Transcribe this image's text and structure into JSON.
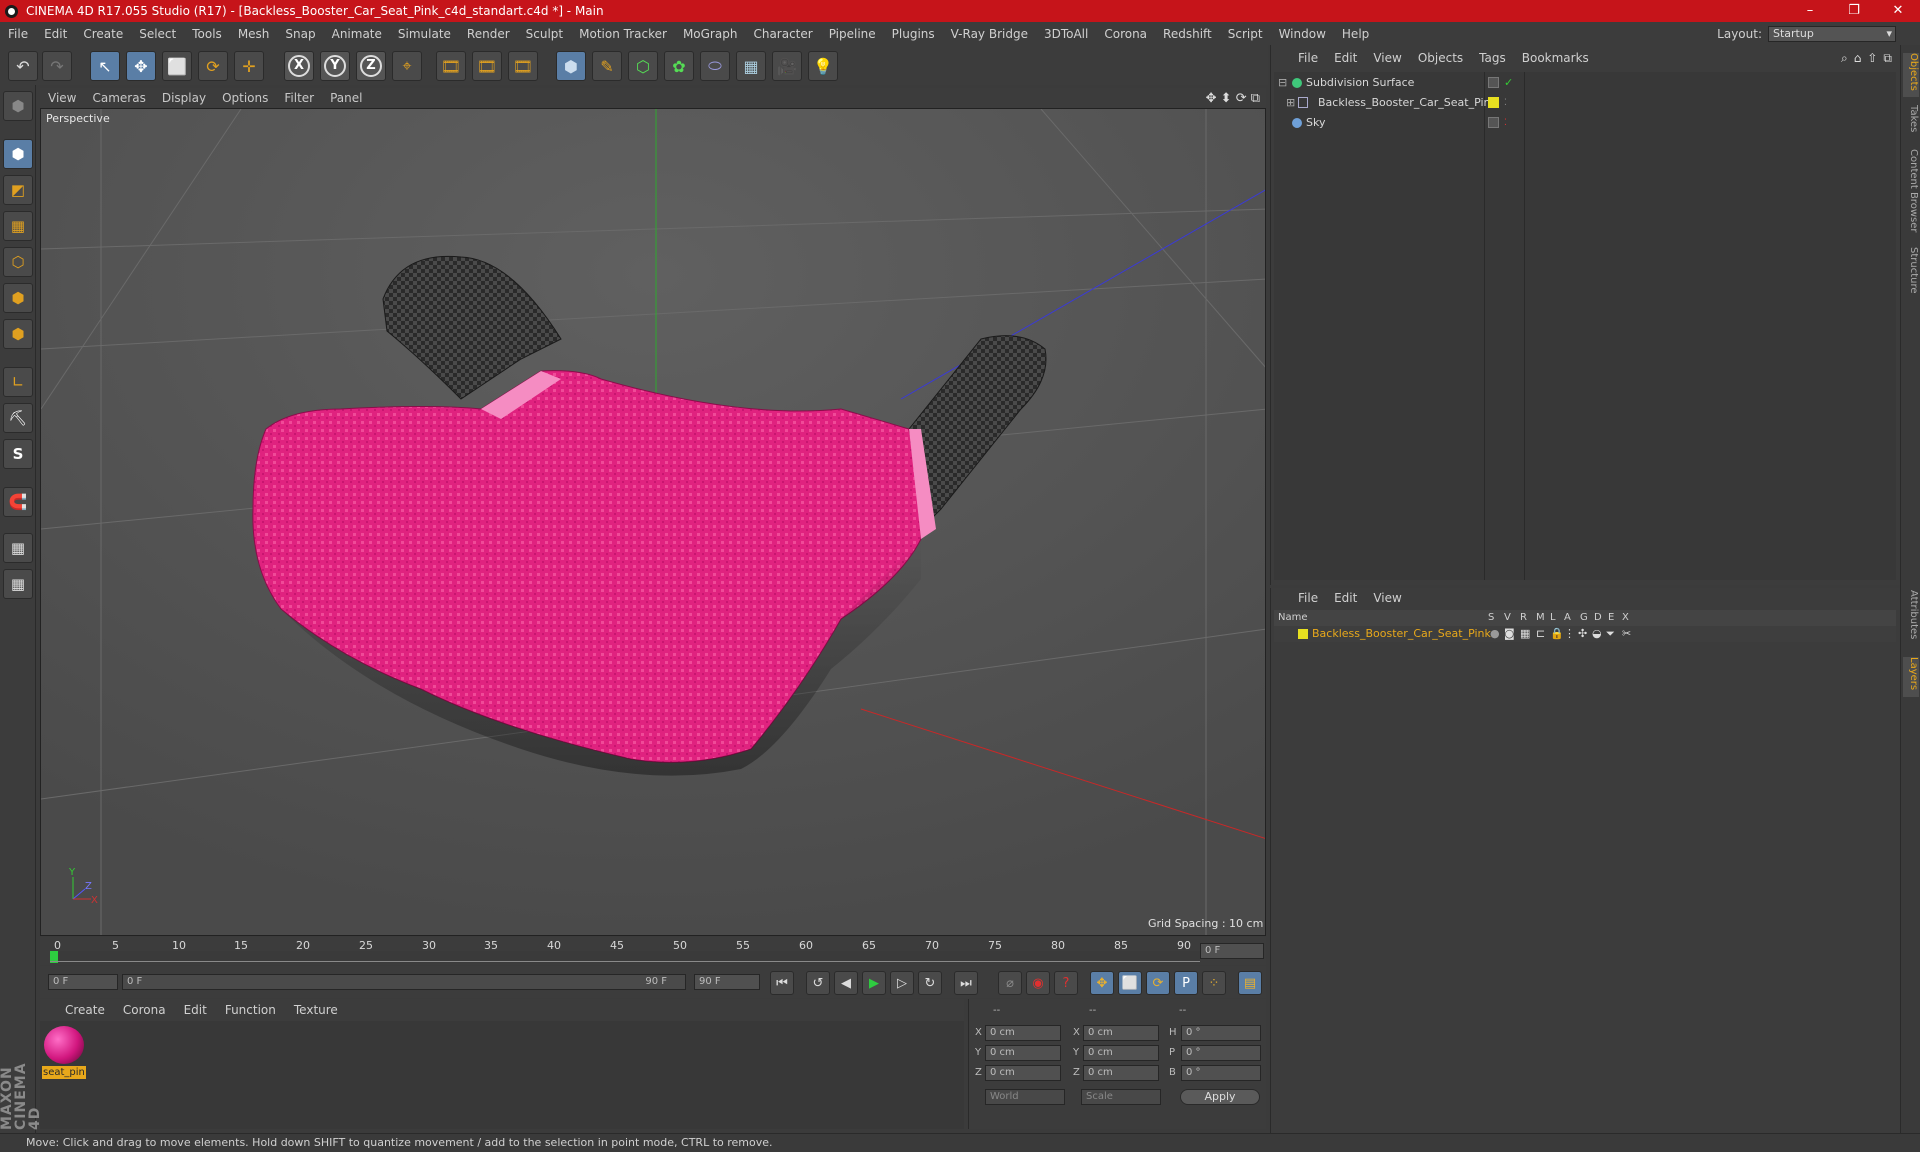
{
  "titlebar": {
    "title": "CINEMA 4D R17.055 Studio (R17) - [Backless_Booster_Car_Seat_Pink_c4d_standart.c4d *] - Main",
    "minimize": "–",
    "maximize": "❐",
    "close": "✕"
  },
  "menu": [
    "File",
    "Edit",
    "Create",
    "Select",
    "Tools",
    "Mesh",
    "Snap",
    "Animate",
    "Simulate",
    "Render",
    "Sculpt",
    "Motion Tracker",
    "MoGraph",
    "Character",
    "Pipeline",
    "Plugins",
    "V-Ray Bridge",
    "3DToAll",
    "Corona",
    "Redshift",
    "Script",
    "Window",
    "Help"
  ],
  "layout": {
    "label": "Layout:",
    "value": "Startup"
  },
  "toolbar": {
    "undo": "↶",
    "redo": "↷",
    "select": "↖",
    "move": "✥",
    "scale": "⬜",
    "rotate": "⟳",
    "move2": "✛",
    "x": "X",
    "y": "Y",
    "z": "Z",
    "coord": "⌖",
    "render1": "🎞",
    "render2": "🎞",
    "render3": "🎞",
    "cube": "⬢",
    "pen": "✎",
    "subdiv": "⬡",
    "array": "✿",
    "deform": "⬭",
    "floor": "▦",
    "camera": "🎥",
    "light": "💡"
  },
  "lefttools": [
    "⬢",
    "◩",
    "▦",
    "⬡",
    "⬢",
    "⬢",
    "∟",
    "⛏",
    "S",
    "🧲",
    "▦",
    "▦"
  ],
  "viewport": {
    "menu": [
      "View",
      "Cameras",
      "Display",
      "Options",
      "Filter",
      "Panel"
    ],
    "icons": "✥ ⬍ ⟳ ⧉",
    "label": "Perspective",
    "grid_spacing": "Grid Spacing : 10 cm",
    "axis_y": "Y",
    "axis_z": "Z",
    "axis_x": "X"
  },
  "timeline": {
    "ticks": [
      "0",
      "5",
      "10",
      "15",
      "20",
      "25",
      "30",
      "35",
      "40",
      "45",
      "50",
      "55",
      "60",
      "65",
      "70",
      "75",
      "80",
      "85",
      "90"
    ],
    "current": "0 F",
    "start": "0 F",
    "range_start": "0 F",
    "range_end": "90 F",
    "end": "90 F"
  },
  "playback": [
    "⏮",
    "↺",
    "◀",
    "▶",
    "▷",
    "↻",
    "⏭"
  ],
  "material_menu": [
    "Create",
    "Corona",
    "Edit",
    "Function",
    "Texture"
  ],
  "material": {
    "name": "seat_pin"
  },
  "coords": {
    "header1": "--",
    "header2": "--",
    "header3": "--",
    "rows": [
      {
        "a": "X",
        "av": "0 cm",
        "b": "X",
        "bv": "0 cm",
        "c": "H",
        "cv": "0 °"
      },
      {
        "a": "Y",
        "av": "0 cm",
        "b": "Y",
        "bv": "0 cm",
        "c": "P",
        "cv": "0 °"
      },
      {
        "a": "Z",
        "av": "0 cm",
        "b": "Z",
        "bv": "0 cm",
        "c": "B",
        "cv": "0 °"
      }
    ],
    "world": "World",
    "scale": "Scale",
    "apply": "Apply"
  },
  "objects": {
    "menu": [
      "File",
      "Edit",
      "View",
      "Objects",
      "Tags",
      "Bookmarks"
    ],
    "items": [
      {
        "name": "Subdivision Surface",
        "color": "#3fc77a"
      },
      {
        "name": "Backless_Booster_Car_Seat_Pink",
        "color": "#e8e020"
      },
      {
        "name": "Sky",
        "color": "#6fa0d8"
      }
    ]
  },
  "layers": {
    "menu": [
      "File",
      "Edit",
      "View"
    ],
    "columns": {
      "name": "Name",
      "s": "S",
      "v": "V",
      "r": "R",
      "m": "M",
      "l": "L",
      "a": "A",
      "g": "G",
      "d": "D",
      "e": "E",
      "x": "X"
    },
    "item": "Backless_Booster_Car_Seat_Pink",
    "item_color": "#e8e020"
  },
  "sidetabs": [
    "Objects",
    "Takes",
    "Content Browser",
    "Structure",
    "Attributes",
    "Layers"
  ],
  "brand": "MAXON CINEMA 4D",
  "status": "Move: Click and drag to move elements. Hold down SHIFT to quantize movement / add to the selection in point mode, CTRL to remove."
}
